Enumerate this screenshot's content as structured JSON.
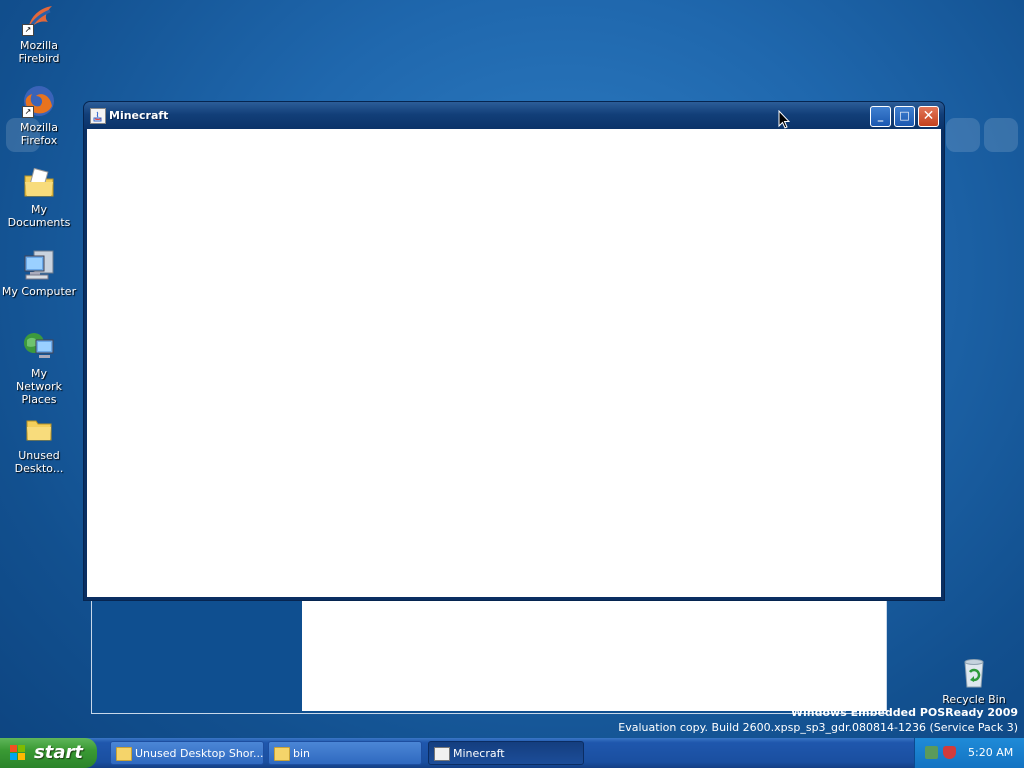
{
  "desktop": {
    "icons": [
      {
        "label": "Mozilla Firebird",
        "icon": "firebird-icon"
      },
      {
        "label": "Mozilla Firefox",
        "icon": "firefox-icon"
      },
      {
        "label": "My Documents",
        "icon": "documents-icon"
      },
      {
        "label": "My Computer",
        "icon": "computer-icon"
      },
      {
        "label": "My Network Places",
        "icon": "network-icon"
      },
      {
        "label": "Unused Deskto...",
        "icon": "folder-icon"
      },
      {
        "label": "Recycle Bin",
        "icon": "recycle-bin-icon"
      }
    ],
    "watermark_line1": "Windows Embedded POSReady 2009",
    "watermark_line2": "Evaluation copy. Build 2600.xpsp_sp3_gdr.080814-1236 (Service Pack 3)"
  },
  "window": {
    "title": "Minecraft",
    "min_symbol": "_",
    "max_symbol": "□",
    "close_symbol": "✕"
  },
  "taskbar": {
    "start_label": "start",
    "tasks": [
      {
        "label": "Unused Desktop Shor..."
      },
      {
        "label": "bin"
      },
      {
        "label": "Minecraft"
      }
    ],
    "clock": "5:20 AM"
  },
  "colors": {
    "desktop": "#1f67ad",
    "titlebar": "#123f79",
    "start_green": "#3a9a34",
    "close_red": "#c4411d"
  }
}
